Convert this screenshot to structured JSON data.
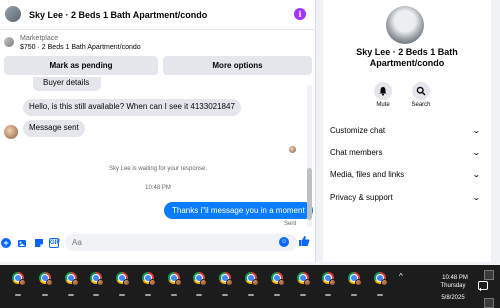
{
  "chat": {
    "title": "Sky Lee · 2 Beds 1 Bath Apartment/condo",
    "info_icon": "info-icon",
    "marketplace_label": "Marketplace",
    "listing": "$750 · 2 Beds 1 Bath Apartment/condo",
    "mark_pending_label": "Mark as pending",
    "more_options_label": "More options",
    "buyer_details_label": "Buyer details",
    "messages": {
      "in1": "Hello, is this still available? When can I see it 4133021847",
      "in2": "Message sent",
      "waiting": "Sky Lee is waiting for your response.",
      "time": "10:48 PM",
      "out1": "Thanks i\"il message you in a moment",
      "status": "Sent"
    },
    "composer": {
      "placeholder": "Aa"
    }
  },
  "info": {
    "name": "Sky Lee · 2 Beds 1 Bath Apartment/condo",
    "actions": {
      "mute": "Mute",
      "search": "Search"
    },
    "sections": {
      "customize": "Customize chat",
      "members": "Chat members",
      "media": "Media, files and links",
      "privacy": "Privacy & support"
    }
  },
  "taskbar": {
    "time": "10:48 PM",
    "day": "Thursday",
    "date": "5/8/2025"
  },
  "colors": {
    "accent": "#0866ff",
    "outgoing_bubble": "#0a7cff",
    "incoming_bubble": "#e4e6eb",
    "taskbar": "#1c1c1c"
  }
}
